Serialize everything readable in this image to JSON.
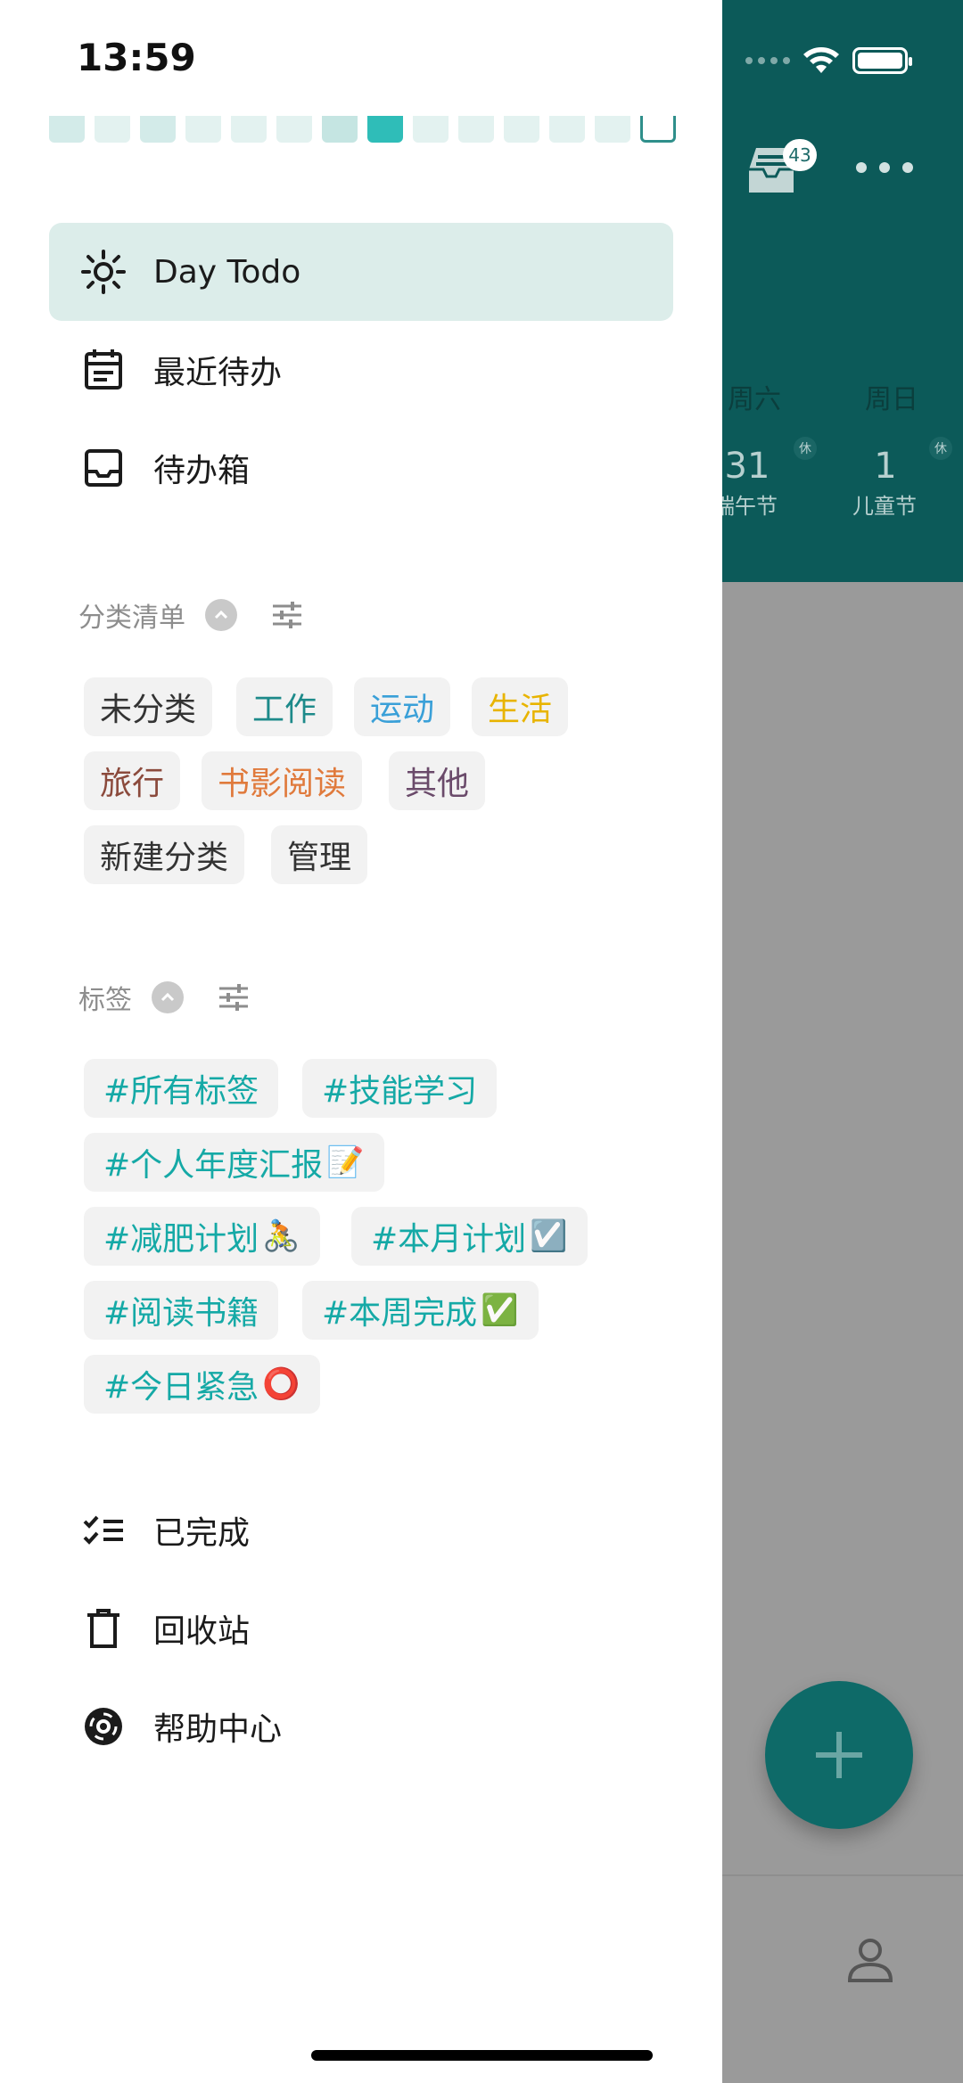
{
  "status": {
    "time": "13:59"
  },
  "heat_colors": [
    "#d3ebe9",
    "#e3f2f0",
    "#d3ebe9",
    "#e3f2f0",
    "#e3f2f0",
    "#e3f2f0",
    "#c5e5e2",
    "#2fbdb8",
    "#e3f2f0",
    "#e3f2f0",
    "#e3f2f0",
    "#e3f2f0",
    "#e3f2f0",
    "#ffffff"
  ],
  "nav": [
    {
      "label": "Day Todo",
      "icon": "sun-icon"
    },
    {
      "label": "最近待办",
      "icon": "calendar-icon"
    },
    {
      "label": "待办箱",
      "icon": "inbox-tray-icon"
    }
  ],
  "categories": {
    "title": "分类清单",
    "items": [
      {
        "label": "未分类",
        "color": "#333333"
      },
      {
        "label": "工作",
        "color": "#1d8a8a"
      },
      {
        "label": "运动",
        "color": "#3aa0d8"
      },
      {
        "label": "生活",
        "color": "#e8b400"
      },
      {
        "label": "旅行",
        "color": "#8b4a3c"
      },
      {
        "label": "书影阅读",
        "color": "#e07a3c"
      },
      {
        "label": "其他",
        "color": "#6a4a6a"
      },
      {
        "label": "新建分类",
        "color": "#333333"
      },
      {
        "label": "管理",
        "color": "#333333"
      }
    ]
  },
  "tags": {
    "title": "标签",
    "items": [
      {
        "label": "#所有标签",
        "emoji": ""
      },
      {
        "label": "#技能学习",
        "emoji": ""
      },
      {
        "label": "#个人年度汇报",
        "emoji": "📝"
      },
      {
        "label": "#减肥计划",
        "emoji": "🚴"
      },
      {
        "label": "#本月计划",
        "emoji": "☑️"
      },
      {
        "label": "#阅读书籍",
        "emoji": ""
      },
      {
        "label": "#本周完成",
        "emoji": "✅"
      },
      {
        "label": "#今日紧急",
        "emoji": "⭕"
      }
    ]
  },
  "bottom_nav": [
    {
      "label": "已完成",
      "icon": "checklist-icon"
    },
    {
      "label": "回收站",
      "icon": "trash-icon"
    },
    {
      "label": "帮助中心",
      "icon": "lifebuoy-icon"
    }
  ],
  "background": {
    "inbox_badge": "43",
    "weekdays": [
      "周六",
      "周日"
    ],
    "days": [
      {
        "num": "31",
        "sub": "端午节",
        "rest": "休"
      },
      {
        "num": "1",
        "sub": "儿童节",
        "rest": "休"
      }
    ]
  }
}
